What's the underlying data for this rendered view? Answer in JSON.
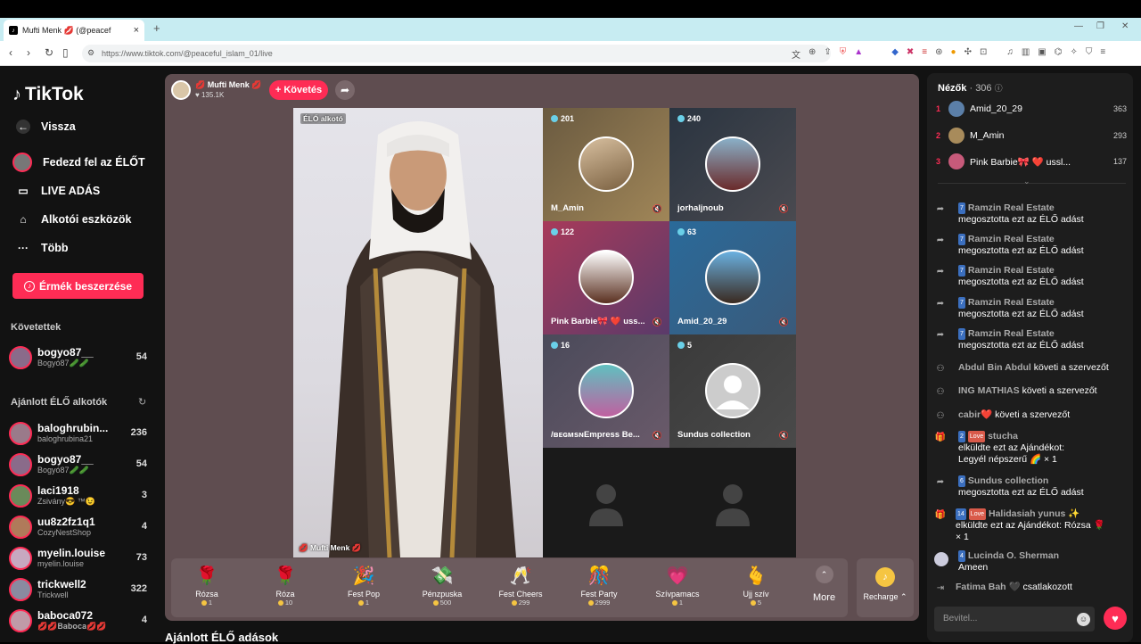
{
  "browser": {
    "tab_title": "Mufti Menk 💋 (@peacef",
    "tab_close": "×",
    "new_tab": "+",
    "url": "https://www.tiktok.com/@peaceful_islam_01/live"
  },
  "sidebar": {
    "logo": "TikTok",
    "nav": [
      {
        "label": "Vissza",
        "icon": "back-arrow-icon"
      },
      {
        "label": "Fedezd fel az ÉLŐT",
        "icon": "explore-icon"
      },
      {
        "label": "LIVE ADÁS",
        "icon": "camera-icon"
      },
      {
        "label": "Alkotói eszközök",
        "icon": "creator-icon"
      },
      {
        "label": "Több",
        "icon": "more-dots-icon"
      }
    ],
    "coins_button": "Érmék beszerzése",
    "following_title": "Követettek",
    "following": [
      {
        "name": "bogyo87__",
        "sub": "Bogyó87🥒🥒",
        "count": "54"
      }
    ],
    "recommended_title": "Ajánlott ÉLŐ alkotók",
    "recommended": [
      {
        "name": "baloghrubin...",
        "sub": "baloghrubina21",
        "count": "236"
      },
      {
        "name": "bogyo87__",
        "sub": "Bogyó87🥒🥒",
        "count": "54"
      },
      {
        "name": "laci1918",
        "sub": "Zsivány😎 ™😉",
        "count": "3"
      },
      {
        "name": "uu8z2fz1q1",
        "sub": "CozyNestShop",
        "count": "4"
      },
      {
        "name": "myelin.louise",
        "sub": "myelin.louise",
        "count": "73"
      },
      {
        "name": "trickwell2",
        "sub": "Trickwell",
        "count": "322"
      },
      {
        "name": "baboca072",
        "sub": "💋💋𝐁𝐚𝐛𝐨𝐜𝐚💋💋",
        "count": "4"
      }
    ]
  },
  "stage": {
    "host_name": "💋 Mufti Menk 💋",
    "host_likes": "♥ 135.1K",
    "follow_button": "+ Követés",
    "main_label": "ÉLŐ alkotó",
    "main_name": "💋 Mufti Menk 💋",
    "guests": [
      {
        "count": "201",
        "name": "M_Amin"
      },
      {
        "count": "240",
        "name": "jorhaljnoub"
      },
      {
        "count": "122",
        "name": "Pink Barbie🎀 ❤️ uss..."
      },
      {
        "count": "63",
        "name": "Amid_20_29"
      },
      {
        "count": "16",
        "name": "/ʙᴇɢᴍsɴEmpress Be..."
      },
      {
        "count": "5",
        "name": "Sundus collection"
      }
    ],
    "gifts": [
      {
        "name": "Rózsa",
        "price": "1",
        "icon": "🌹"
      },
      {
        "name": "Róza",
        "price": "10",
        "icon": "🌹"
      },
      {
        "name": "Fest Pop",
        "price": "1",
        "icon": "🎉"
      },
      {
        "name": "Pénzpuska",
        "price": "500",
        "icon": "💸"
      },
      {
        "name": "Fest Cheers",
        "price": "299",
        "icon": "🥂"
      },
      {
        "name": "Fest Party",
        "price": "2999",
        "icon": "🎊"
      },
      {
        "name": "Szívpamacs",
        "price": "1",
        "icon": "💗"
      },
      {
        "name": "Ujj szív",
        "price": "5",
        "icon": "🫰"
      }
    ],
    "more_label": "More",
    "recharge_label": "Recharge ⌃"
  },
  "bottom_title": "Ajánlott ÉLŐ adások",
  "panel": {
    "viewers_label": "Nézők",
    "viewers_count": "· 306",
    "ranking": [
      {
        "rank": "1",
        "name": "Amid_20_29",
        "score": "363",
        "color": "#5b7fa8"
      },
      {
        "rank": "2",
        "name": "M_Amin",
        "score": "293",
        "color": "#a88b5b"
      },
      {
        "rank": "3",
        "name": "Pink Barbie🎀 ❤️ ussl...",
        "score": "137",
        "color": "#c75a7a"
      }
    ],
    "messages": [
      {
        "type": "share",
        "badge": "7",
        "user": "Ramzin Real Estate",
        "text": "megosztotta ezt az ÉLŐ adást"
      },
      {
        "type": "share",
        "badge": "7",
        "user": "Ramzin Real Estate",
        "text": "megosztotta ezt az ÉLŐ adást"
      },
      {
        "type": "share",
        "badge": "7",
        "user": "Ramzin Real Estate",
        "text": "megosztotta ezt az ÉLŐ adást"
      },
      {
        "type": "share",
        "badge": "7",
        "user": "Ramzin Real Estate",
        "text": "megosztotta ezt az ÉLŐ adást"
      },
      {
        "type": "share",
        "badge": "7",
        "user": "Ramzin Real Estate",
        "text": "megosztotta ezt az ÉLŐ adást"
      },
      {
        "type": "follow",
        "user": "Abdul Bin Abdul",
        "text": "követi a szervezőt"
      },
      {
        "type": "follow",
        "user": "ING MATHIAS",
        "text": "követi a szervezőt"
      },
      {
        "type": "follow",
        "user": "cabir❤️",
        "text": "követi a szervezőt"
      },
      {
        "type": "gift",
        "badge": "2",
        "love": "Love",
        "user": "stucha",
        "text": "elküldte ezt az Ajándékot:",
        "text2": "Legyél népszerű 🌈 × 1"
      },
      {
        "type": "share",
        "badge": "6",
        "user": "Sundus collection",
        "text": "megosztotta ezt az ÉLŐ adást"
      },
      {
        "type": "gift",
        "badge": "14",
        "love": "Love",
        "user": "Halidasiah yunus ✨",
        "text": "elküldte ezt az Ajándékot: Rózsa 🌹",
        "text2": "× 1"
      },
      {
        "type": "chat",
        "badge": "4",
        "user": "Lucinda O. Sherman",
        "text": "Ameen"
      },
      {
        "type": "join",
        "user": "Fatima Bah 🖤",
        "text": "csatlakozott"
      }
    ],
    "input_placeholder": "Bevitel..."
  }
}
